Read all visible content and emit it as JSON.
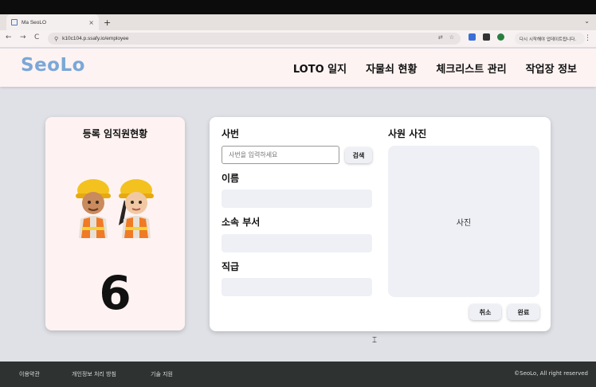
{
  "browser": {
    "tab_title": "Ma SeoLO",
    "tab_close": "×",
    "new_tab": "+",
    "menu_chevron": "⌄",
    "back": "←",
    "forward": "→",
    "reload": "C",
    "url": "k10c104.p.ssafy.io/employee",
    "profile_text": "다시 시작해야 업데이트됩니다.",
    "menu": "⋮",
    "extension_colors": [
      "#3b6fd6",
      "#333333",
      "#2a7f3f"
    ]
  },
  "header": {
    "logo": "SeoLo",
    "nav": [
      "LOTO 일지",
      "자물쇠 현황",
      "체크리스트 관리",
      "작업장 정보"
    ]
  },
  "summary": {
    "title": "등록 임직원현황",
    "count": "6"
  },
  "form": {
    "employee_id_label": "사번",
    "search_placeholder": "사번을 입력하세요",
    "search_button": "검색",
    "name_label": "이름",
    "department_label": "소속 부서",
    "position_label": "직급",
    "photo_label": "사원 사진",
    "photo_placeholder": "사진",
    "cancel_button": "취소",
    "done_button": "완료"
  },
  "footer": {
    "terms": "이용약관",
    "privacy": "개인정보 처리 방침",
    "support": "기술 지원",
    "copyright": "©SeoLo, All right reserved"
  },
  "colors": {
    "accent_logo": "#7aa7d8",
    "header_bg": "#fdf3f2",
    "page_bg": "#dfe1e6",
    "field_bg": "#eef0f5",
    "footer_bg": "#2e3231"
  }
}
